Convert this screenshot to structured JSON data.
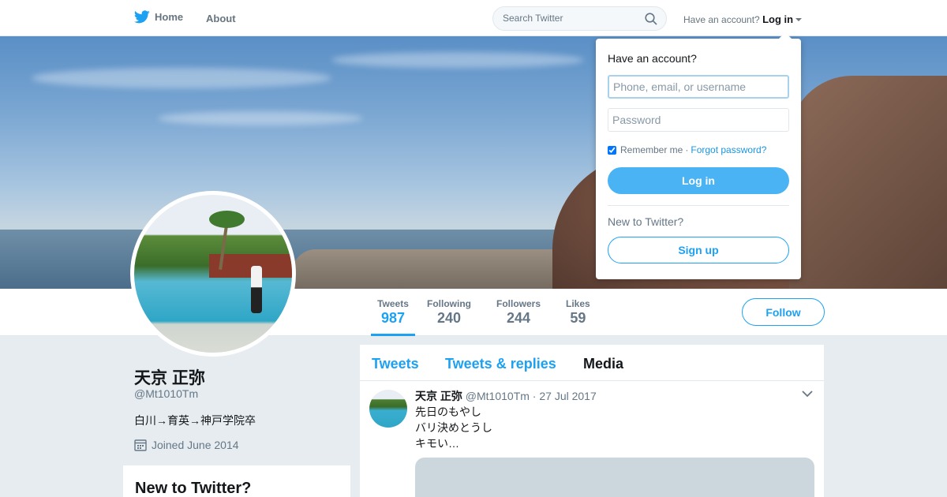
{
  "nav": {
    "home_label": "Home",
    "about_label": "About",
    "search_placeholder": "Search Twitter",
    "have_account": "Have an account?",
    "login_label": "Log in"
  },
  "profile": {
    "name": "天京 正弥",
    "handle": "@Mt1010Tm",
    "bio": "白川→育英→神戸学院卒",
    "joined": "Joined June 2014"
  },
  "stats": [
    {
      "label": "Tweets",
      "value": "987"
    },
    {
      "label": "Following",
      "value": "240"
    },
    {
      "label": "Followers",
      "value": "244"
    },
    {
      "label": "Likes",
      "value": "59"
    }
  ],
  "follow_label": "Follow",
  "new_to_twitter_card": "New to Twitter?",
  "timeline": {
    "tabs": [
      "Tweets",
      "Tweets & replies",
      "Media"
    ],
    "current_tab": "Media",
    "tweet": {
      "name": "天京 正弥",
      "handle": "@Mt1010Tm",
      "separator": "·",
      "date": "27 Jul 2017",
      "lines": [
        "先日のもやし",
        "バリ決めとうし",
        "キモい…"
      ]
    }
  },
  "login_dropdown": {
    "title": "Have an account?",
    "username_placeholder": "Phone, email, or username",
    "password_placeholder": "Password",
    "remember_me": "Remember me",
    "separator": "·",
    "forgot_password": "Forgot password?",
    "login_button": "Log in",
    "new_to_twitter": "New to Twitter?",
    "signup_button": "Sign up"
  },
  "colors": {
    "accent": "#1da1f2",
    "background": "#e6ecf0"
  },
  "icons": [
    "twitter-bird-icon",
    "search-icon",
    "caret-down-icon",
    "calendar-icon",
    "chevron-down-icon"
  ]
}
